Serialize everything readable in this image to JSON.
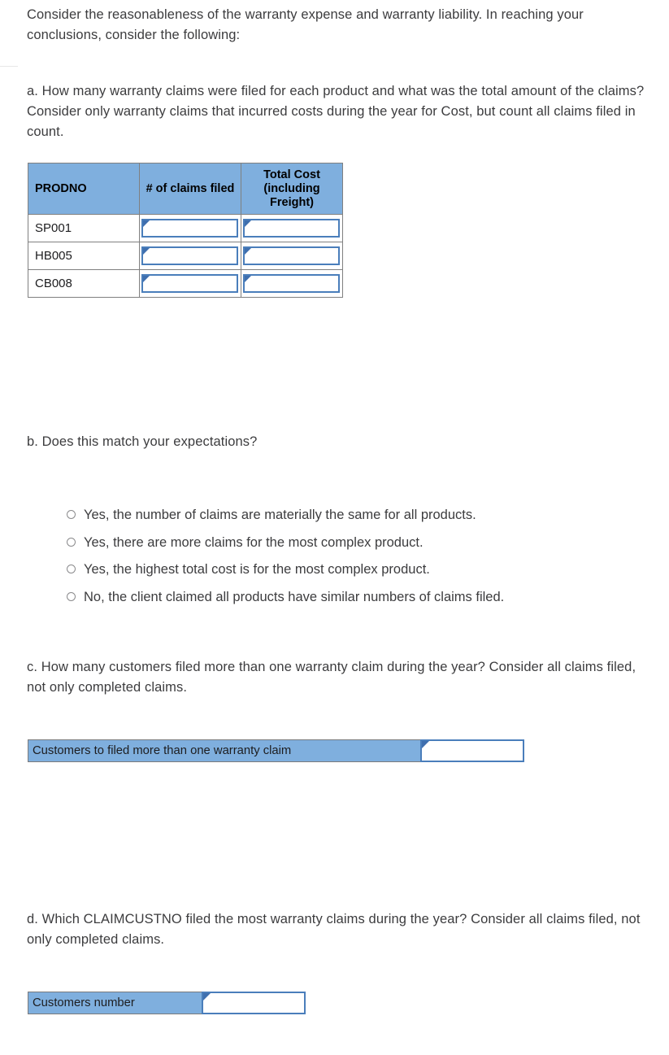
{
  "intro": {
    "text": "Consider the reasonableness of the warranty expense and warranty liability. In reaching your conclusions, consider the following:"
  },
  "questions": {
    "a": "a. How many warranty claims were filed for each product and what was the total amount of the claims? Consider only warranty claims that incurred costs during the year for Cost, but count all claims filed in count.",
    "b": "b. Does this match your expectations?",
    "c": "c. How many customers filed more than one warranty claim during the year? Consider all claims filed, not only completed claims.",
    "d": "d. Which CLAIMCUSTNO filed the most warranty claims during the year? Consider all claims filed, not only completed claims."
  },
  "claims_table": {
    "headers": [
      "PRODNO",
      "# of claims filed",
      "Total Cost (including Freight)"
    ],
    "rows": [
      {
        "prodno": "SP001",
        "claims_filed": "",
        "total_cost": ""
      },
      {
        "prodno": "HB005",
        "claims_filed": "",
        "total_cost": ""
      },
      {
        "prodno": "CB008",
        "claims_filed": "",
        "total_cost": ""
      }
    ]
  },
  "options_b": [
    {
      "label": "Yes, the number of claims are materially the same for all products.",
      "selected": false
    },
    {
      "label": "Yes, there are more claims for the most complex product.",
      "selected": false
    },
    {
      "label": "Yes, the highest total cost is for the most complex product.",
      "selected": false
    },
    {
      "label": "No, the client claimed all products have similar numbers of claims filed.",
      "selected": false
    }
  ],
  "answer_c": {
    "label": "Customers to filed more than one warranty claim",
    "value": ""
  },
  "answer_d": {
    "label": "Customers number",
    "value": ""
  },
  "colors": {
    "header_blue": "#7FAFDE",
    "input_border_blue": "#4A7EBB",
    "marker_blue": "#3F6FAE",
    "body_text": "#3C3C3E",
    "cell_border": "#808080"
  }
}
